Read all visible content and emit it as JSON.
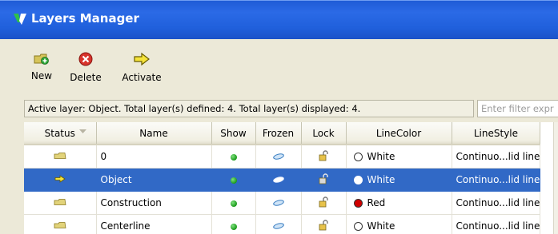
{
  "window": {
    "title": "Layers Manager"
  },
  "toolbar": {
    "new_label": "New",
    "delete_label": "Delete",
    "activate_label": "Activate"
  },
  "status": {
    "text": "Active layer: Object. Total layer(s) defined: 4. Total layer(s) displayed: 4."
  },
  "filter": {
    "placeholder": "Enter filter expr"
  },
  "columns": {
    "status": "Status",
    "name": "Name",
    "show": "Show",
    "frozen": "Frozen",
    "lock": "Lock",
    "linecolor": "LineColor",
    "linestyle": "LineStyle"
  },
  "rows": [
    {
      "status_icon": "folder-icon",
      "name": "0",
      "show": "on",
      "frozen": "no",
      "lock": "unlocked",
      "color_name": "White",
      "color_hex": "#ffffff",
      "linestyle": "Continuo...lid line",
      "selected": false
    },
    {
      "status_icon": "arrow-active-icon",
      "name": "Object",
      "show": "on",
      "frozen": "no",
      "lock": "unlocked",
      "color_name": "White",
      "color_hex": "#ffffff",
      "linestyle": "Continuo...lid line",
      "selected": true
    },
    {
      "status_icon": "folder-icon",
      "name": "Construction",
      "show": "on",
      "frozen": "no",
      "lock": "unlocked",
      "color_name": "Red",
      "color_hex": "#d00000",
      "linestyle": "Continuo...lid line",
      "selected": false
    },
    {
      "status_icon": "folder-icon",
      "name": "Centerline",
      "show": "on",
      "frozen": "no",
      "lock": "unlocked",
      "color_name": "White",
      "color_hex": "#ffffff",
      "linestyle": "Continuo...lid line",
      "selected": false
    }
  ],
  "colors": {
    "titlebar": "#2060dc",
    "selection": "#3169c6",
    "show_on": "#1a9a1a",
    "activate_arrow": "#f5e33a"
  }
}
